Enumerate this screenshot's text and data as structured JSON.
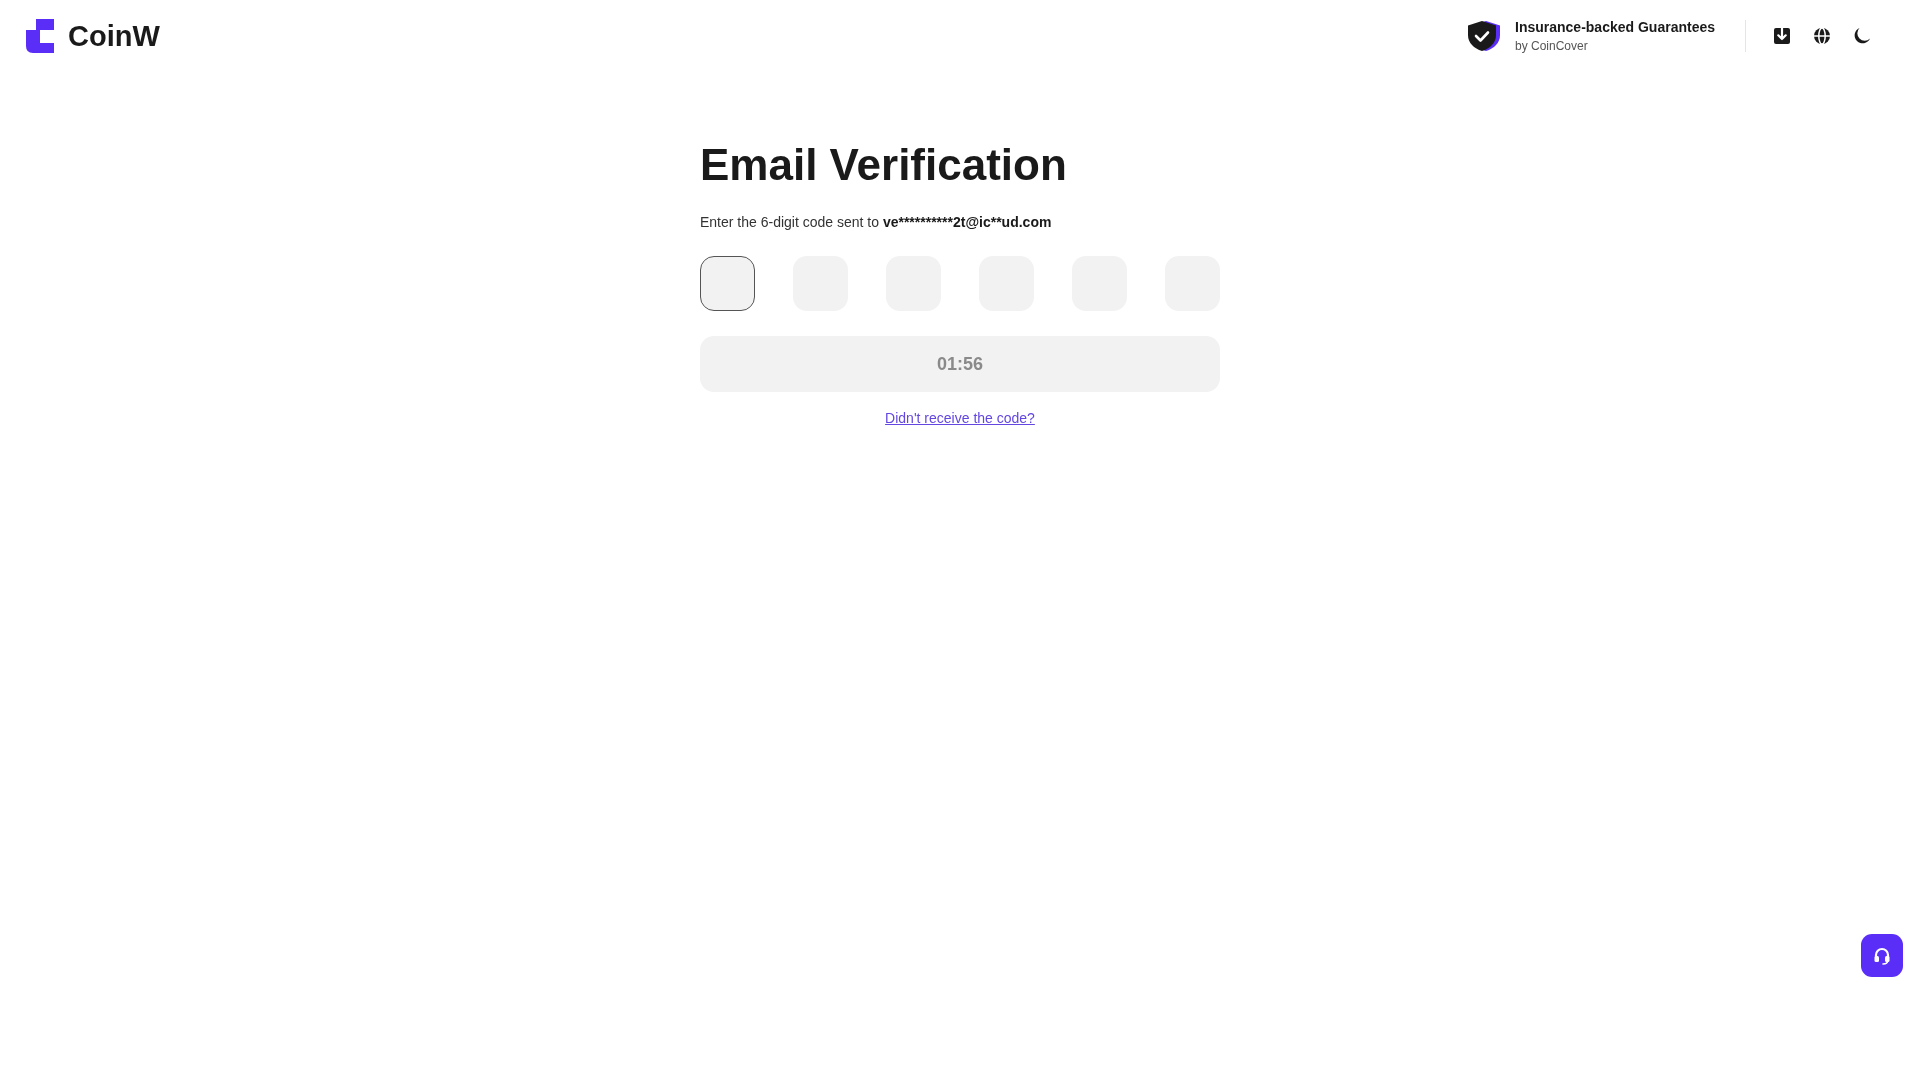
{
  "header": {
    "logo": "CoinW",
    "insurance": {
      "title": "Insurance-backed Guarantees",
      "subtitle": "by CoinCover"
    }
  },
  "title": "Email Verification",
  "instruction": {
    "text": "Enter the 6-digit code sent to",
    "email": "ve**********2t@ic**ud.com"
  },
  "code_inputs": [
    {
      "focused": true
    },
    {
      "focused": false
    },
    {
      "focused": false
    },
    {
      "focused": false
    },
    {
      "focused": false
    },
    {
      "focused": false
    }
  ],
  "timer_button": {
    "label": "01:56",
    "disabled": true
  },
  "resend_link": "Didn't receive the code?"
}
